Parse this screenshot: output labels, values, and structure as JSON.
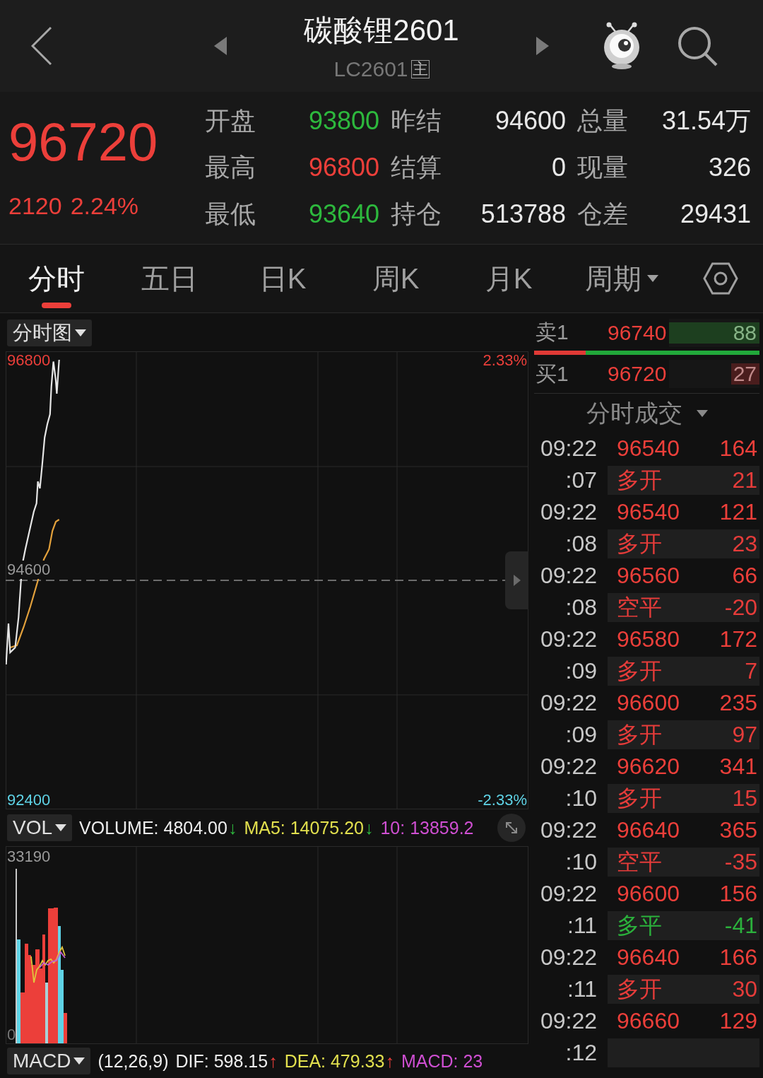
{
  "header": {
    "title": "碳酸锂2601",
    "code": "LC2601",
    "badge": "主"
  },
  "quote": {
    "price": "96720",
    "change": "2120",
    "change_pct": "2.24%",
    "stats": [
      {
        "label": "开盘",
        "value": "93800",
        "color": "#2db83d"
      },
      {
        "label": "昨结",
        "value": "94600",
        "color": "#e8e8e8"
      },
      {
        "label": "总量",
        "value": "31.54万",
        "color": "#e8e8e8"
      },
      {
        "label": "最高",
        "value": "96800",
        "color": "#ec3f3a"
      },
      {
        "label": "结算",
        "value": "0",
        "color": "#e8e8e8"
      },
      {
        "label": "现量",
        "value": "326",
        "color": "#e8e8e8"
      },
      {
        "label": "最低",
        "value": "93640",
        "color": "#2db83d"
      },
      {
        "label": "持仓",
        "value": "513788",
        "color": "#e8e8e8"
      },
      {
        "label": "仓差",
        "value": "29431",
        "color": "#e8e8e8"
      }
    ]
  },
  "tabs": [
    {
      "label": "分时",
      "selected": true,
      "kind": "tab"
    },
    {
      "label": "五日",
      "selected": false,
      "kind": "tab"
    },
    {
      "label": "日K",
      "selected": false,
      "kind": "tab"
    },
    {
      "label": "周K",
      "selected": false,
      "kind": "tab"
    },
    {
      "label": "月K",
      "selected": false,
      "kind": "tab"
    },
    {
      "label": "周期",
      "selected": false,
      "kind": "dropdown"
    }
  ],
  "intraday_chart": {
    "selector": "分时图",
    "price_high": "96800",
    "pct_high": "2.33%",
    "price_ref": "94600",
    "price_low": "92400",
    "pct_low": "-2.33%"
  },
  "volume_panel": {
    "selector": "VOL",
    "indicators": [
      {
        "text": "VOLUME: 4804.00",
        "color": "#eeeeee",
        "arrow": {
          "glyph": "↓",
          "color": "#2db83d"
        }
      },
      {
        "text": "MA5: 14075.20",
        "color": "#e2e04e",
        "arrow": {
          "glyph": "↓",
          "color": "#2db83d"
        }
      },
      {
        "text": "10: 13859.2",
        "color": "#cf4fd2"
      }
    ],
    "axis_max": "33190",
    "axis_min": "0"
  },
  "macd_panel": {
    "selector": "MACD",
    "params": "(12,26,9)",
    "indicators": [
      {
        "text": "DIF: 598.15",
        "color": "#eeeeee",
        "arrow": {
          "glyph": "↑",
          "color": "#ec3f3a"
        }
      },
      {
        "text": "DEA: 479.33",
        "color": "#e2e04e",
        "arrow": {
          "glyph": "↑",
          "color": "#ec3f3a"
        }
      },
      {
        "text": "MACD: 23",
        "color": "#cf4fd2"
      }
    ]
  },
  "order_book": {
    "levels": [
      {
        "kind": "ask",
        "label": "卖1",
        "price": "96740",
        "volume": "88",
        "level": 1
      },
      {
        "kind": "bid",
        "label": "买1",
        "price": "96720",
        "volume": "27",
        "level": 0.31
      }
    ],
    "ratio_bar": {
      "level": 0.23
    }
  },
  "trades": {
    "title": "分时成交",
    "rows": [
      {
        "kind": "main",
        "time": "09:22",
        "price": "96540",
        "volume": "164"
      },
      {
        "kind": "sub",
        "time": ":07",
        "action": "多开",
        "volume": "21",
        "color": "#e63c3a"
      },
      {
        "kind": "main",
        "time": "09:22",
        "price": "96540",
        "volume": "121"
      },
      {
        "kind": "sub",
        "time": ":08",
        "action": "多开",
        "volume": "23",
        "color": "#e63c3a"
      },
      {
        "kind": "main",
        "time": "09:22",
        "price": "96560",
        "volume": "66"
      },
      {
        "kind": "sub",
        "time": ":08",
        "action": "空平",
        "volume": "-20",
        "color": "#e63c3a"
      },
      {
        "kind": "main",
        "time": "09:22",
        "price": "96580",
        "volume": "172"
      },
      {
        "kind": "sub",
        "time": ":09",
        "action": "多开",
        "volume": "7",
        "color": "#e63c3a"
      },
      {
        "kind": "main",
        "time": "09:22",
        "price": "96600",
        "volume": "235"
      },
      {
        "kind": "sub",
        "time": ":09",
        "action": "多开",
        "volume": "97",
        "color": "#e63c3a"
      },
      {
        "kind": "main",
        "time": "09:22",
        "price": "96620",
        "volume": "341"
      },
      {
        "kind": "sub",
        "time": ":10",
        "action": "多开",
        "volume": "15",
        "color": "#e63c3a"
      },
      {
        "kind": "main",
        "time": "09:22",
        "price": "96640",
        "volume": "365"
      },
      {
        "kind": "sub",
        "time": ":10",
        "action": "空平",
        "volume": "-35",
        "color": "#e63c3a"
      },
      {
        "kind": "main",
        "time": "09:22",
        "price": "96600",
        "volume": "156"
      },
      {
        "kind": "sub",
        "time": ":11",
        "action": "多平",
        "volume": "-41",
        "color": "#2bb13c"
      },
      {
        "kind": "main",
        "time": "09:22",
        "price": "96640",
        "volume": "166"
      },
      {
        "kind": "sub",
        "time": ":11",
        "action": "多开",
        "volume": "30",
        "color": "#e63c3a"
      },
      {
        "kind": "main",
        "time": "09:22",
        "price": "96660",
        "volume": "129"
      },
      {
        "kind": "sub",
        "time": ":12"
      }
    ]
  }
}
